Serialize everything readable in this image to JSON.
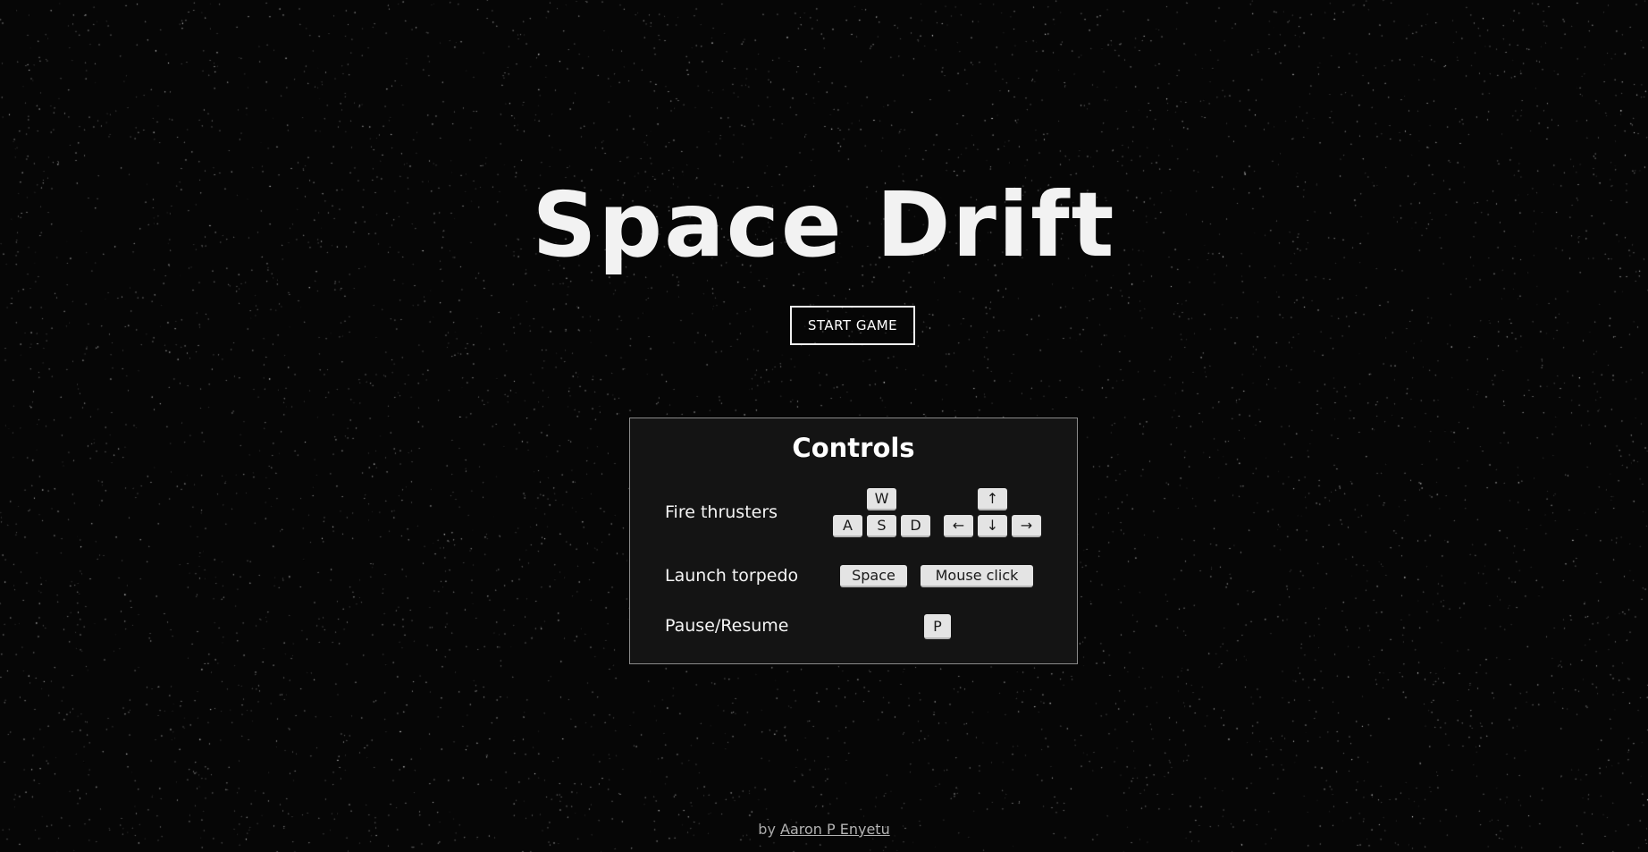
{
  "game": {
    "title": "Space Drift",
    "start_button_label": "START GAME"
  },
  "controls": {
    "heading": "Controls",
    "rows": [
      {
        "label": "Fire thrusters",
        "keys_letters": [
          "W",
          "A",
          "S",
          "D"
        ],
        "keys_arrows": [
          "↑",
          "←",
          "↓",
          "→"
        ]
      },
      {
        "label": "Launch torpedo",
        "keys": [
          "Space",
          "Mouse click"
        ]
      },
      {
        "label": "Pause/Resume",
        "keys": [
          "P"
        ]
      }
    ]
  },
  "footer": {
    "by_text": "by",
    "author_link": "Aaron P Enyetu"
  },
  "colors": {
    "background": "#060606",
    "text": "#ffffff",
    "panel_background": "#141414",
    "panel_border": "#8a8a8a",
    "key_background": "#e4e4e4",
    "key_text": "#1a1a1a",
    "footer_text": "#a9a9a9"
  }
}
